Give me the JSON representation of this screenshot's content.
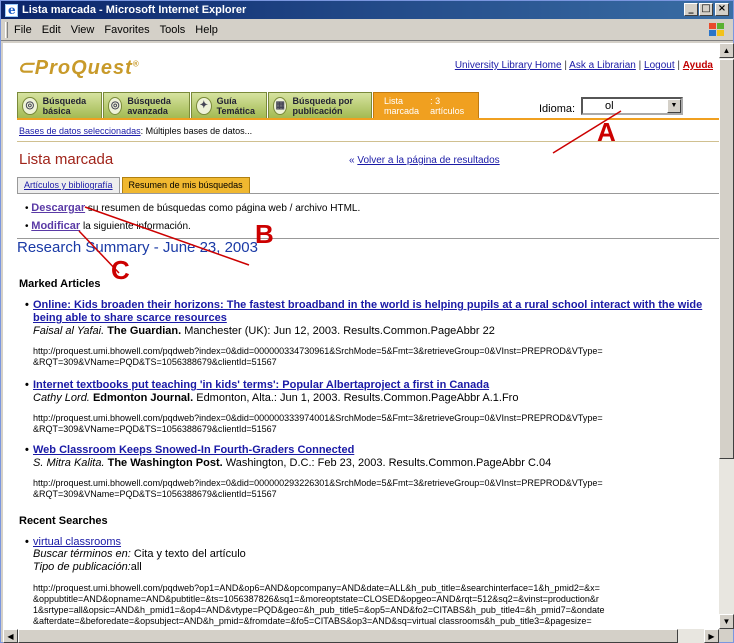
{
  "window": {
    "title": "Lista marcada - Microsoft Internet Explorer",
    "controls": [
      "_",
      "□",
      "×"
    ]
  },
  "menubar": {
    "items": [
      "File",
      "Edit",
      "View",
      "Favorites",
      "Tools",
      "Help"
    ]
  },
  "header": {
    "logo_text": "ProQuest",
    "links": [
      "University Library Home",
      "Ask a Librarian",
      "Logout"
    ],
    "help_link": "Ayuda",
    "separator": "|"
  },
  "nav": {
    "tabs": [
      {
        "label": "Búsqueda básica",
        "icon": "basic-search-icon"
      },
      {
        "label": "Búsqueda avanzada",
        "icon": "advanced-search-icon"
      },
      {
        "label": "Guía Temática",
        "icon": "topic-guide-icon"
      },
      {
        "label": "Búsqueda por publicación",
        "icon": "publication-search-icon"
      }
    ],
    "marked_list_label": "Lista marcada",
    "marked_list_count": ": 3 artículos",
    "language_label": "Idioma:",
    "language_value": "ol"
  },
  "database_line": {
    "link": "Bases de datos seleccionadas",
    "text": ": Múltiples bases de datos..."
  },
  "page": {
    "title": "Lista marcada",
    "back_prefix": "«",
    "back_link": "Volver a la página de resultados"
  },
  "subtabs": [
    {
      "label": "Artículos y bibliografía",
      "active": false
    },
    {
      "label": "Resumen de mis búsquedas",
      "active": true
    }
  ],
  "actions": [
    {
      "link": "Descargar",
      "text": " su resumen de búsquedas como página web / archivo HTML."
    },
    {
      "link": "Modificar",
      "text": " la siguiente información."
    }
  ],
  "summary_title": "Research Summary - June 23, 2003",
  "marked_articles": {
    "heading": "Marked Articles",
    "items": [
      {
        "title_line1": "Online: Kids broaden their horizons: The fastest broadband in the world is helping pupils at a rural school interact with the wide",
        "title_line2": "being able to share scarce resources",
        "author": "Faisal al Yafai.",
        "publication": "The Guardian.",
        "details": " Manchester (UK): Jun 12, 2003. Results.Common.PageAbbr 22",
        "url_line1": "http://proquest.umi.bhowell.com/pqdweb?index=0&did=000000334730961&SrchMode=5&Fmt=3&retrieveGroup=0&VInst=PREPROD&VType=",
        "url_line2": "&RQT=309&VName=PQD&TS=1056388679&clientId=51567"
      },
      {
        "title_line1": "Internet textbooks put teaching 'in kids' terms': Popular Albertaproject a first in Canada",
        "title_line2": "",
        "author": "Cathy Lord.",
        "publication": "Edmonton Journal.",
        "details": " Edmonton, Alta.: Jun 1, 2003. Results.Common.PageAbbr A.1.Fro",
        "url_line1": "http://proquest.umi.bhowell.com/pqdweb?index=0&did=000000333974001&SrchMode=5&Fmt=3&retrieveGroup=0&VInst=PREPROD&VType=",
        "url_line2": "&RQT=309&VName=PQD&TS=1056388679&clientId=51567"
      },
      {
        "title_line1": "Web Classroom Keeps Snowed-In Fourth-Graders Connected",
        "title_line2": "",
        "author": "S. Mitra Kalita.",
        "publication": "The Washington Post.",
        "details": " Washington, D.C.: Feb 23, 2003. Results.Common.PageAbbr C.04",
        "url_line1": "http://proquest.umi.bhowell.com/pqdweb?index=0&did=000000293226301&SrchMode=5&Fmt=3&retrieveGroup=0&VInst=PREPROD&VType=",
        "url_line2": "&RQT=309&VName=PQD&TS=1056388679&clientId=51567"
      }
    ]
  },
  "recent_searches": {
    "heading": "Recent Searches",
    "items": [
      {
        "link": "virtual classrooms",
        "line1_label": "Buscar términos en:",
        "line1_value": " Cita y texto del artículo",
        "line2_label": "Tipo de publicación:",
        "line2_value": "all",
        "url_lines": [
          "http://proquest.umi.bhowell.com/pqdweb?op1=AND&op6=AND&opcompany=AND&date=ALL&h_pub_title=&searchinterface=1&h_pmid2=&x=",
          "&oppubtitle=AND&opname=AND&pubtitle=&ts=1056387826&sq1=&moreoptstate=CLOSED&opgeo=AND&rqt=512&sq2=&vinst=production&r",
          "1&srtype=all&opsic=AND&h_pmid1=&op4=AND&vtype=PQD&geo=&h_pub_title5=&op5=AND&fo2=CITABS&h_pub_title4=&h_pmid7=&ondate",
          "&afterdate=&beforedate=&opsubject=AND&h_pmid=&fromdate=&fo5=CITABS&op3=AND&sq=virtual classrooms&h_pub_title3=&pagesize="
        ]
      }
    ]
  },
  "annotations": {
    "a": "A",
    "b": "B",
    "c": "C"
  },
  "colors": {
    "marker": "#cc0000",
    "link": "#1a1aa6",
    "title": "#a0241a",
    "accent_orange": "#f0a020"
  }
}
